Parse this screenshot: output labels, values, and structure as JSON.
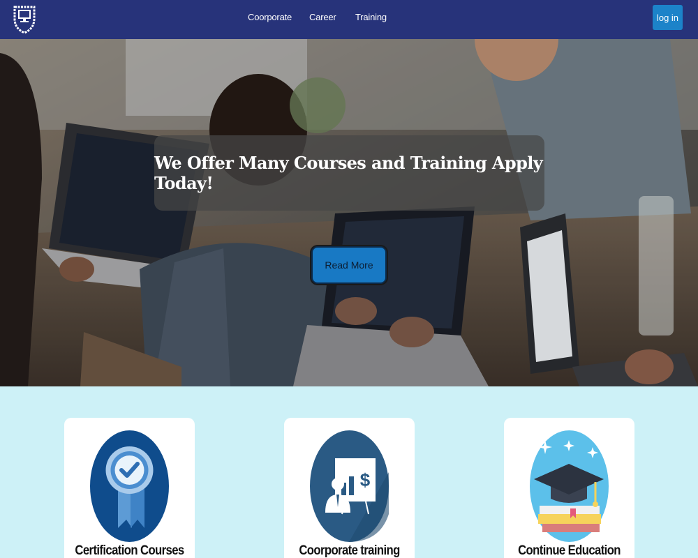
{
  "nav": {
    "links": [
      "Coorporate",
      "Career",
      "Training"
    ],
    "login_label": "log in",
    "logo_icon": "shield-monitor-icon",
    "background": "#27337a"
  },
  "hero": {
    "title": "We Offer Many Courses and Training Apply Today!",
    "button_label": "Read More",
    "button_color": "#1879c4"
  },
  "cards": [
    {
      "title": "Certification Courses",
      "icon": "certificate-badge-icon"
    },
    {
      "title": "Coorporate training",
      "icon": "presentation-board-icon"
    },
    {
      "title": "Continue Education",
      "icon": "graduation-cap-icon"
    }
  ],
  "colors": {
    "section_bg": "#cdf1f7",
    "card_bg": "#ffffff"
  }
}
